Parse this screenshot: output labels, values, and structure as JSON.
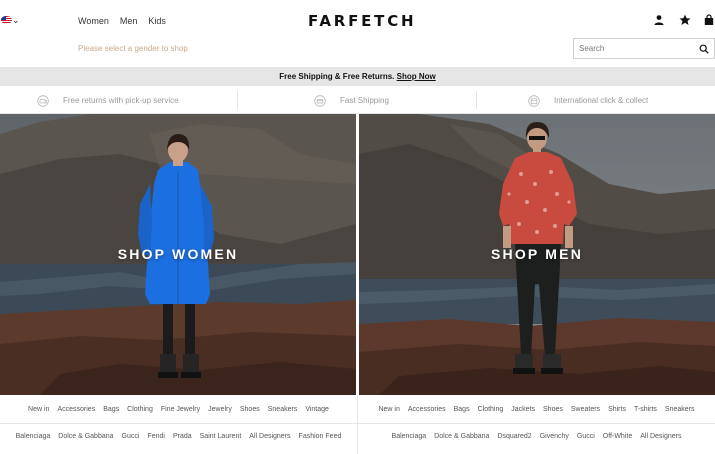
{
  "header": {
    "locale_icon": "us-flag-icon",
    "gender_nav": [
      "Women",
      "Men",
      "Kids"
    ],
    "gender_hint": "Please select a gender to shop",
    "logo": "FARFETCH",
    "search_placeholder": "Search",
    "icons": [
      "account-icon",
      "wishlist-star-icon",
      "bag-icon"
    ]
  },
  "promo": {
    "text": "Free Shipping & Free Returns.",
    "link": "Shop Now"
  },
  "features": [
    {
      "icon": "returns-pickup-icon",
      "label": "Free returns with pick-up service"
    },
    {
      "icon": "fast-shipping-icon",
      "label": "Fast Shipping"
    },
    {
      "icon": "click-collect-icon",
      "label": "International click & collect"
    }
  ],
  "hero": {
    "women": "SHOP WOMEN",
    "men": "SHOP MEN"
  },
  "women_links": {
    "categories": [
      "New in",
      "Accessories",
      "Bags",
      "Clothing",
      "Fine Jewelry",
      "Jewelry",
      "Shoes",
      "Sneakers",
      "Vintage"
    ],
    "designers": [
      "Balenciaga",
      "Dolce & Gabbana",
      "Gucci",
      "Fendi",
      "Prada",
      "Saint Laurent",
      "All Designers",
      "Fashion Feed"
    ]
  },
  "men_links": {
    "categories": [
      "New in",
      "Accessories",
      "Bags",
      "Clothing",
      "Jackets",
      "Shoes",
      "Sweaters",
      "Shirts",
      "T-shirts",
      "Sneakers"
    ],
    "designers": [
      "Balenciaga",
      "Dolce & Gabbana",
      "Dsquared2",
      "Givenchy",
      "Gucci",
      "Off-White",
      "All Designers"
    ]
  },
  "colors": {
    "promo_bg": "#e6e6e6",
    "hint_text": "#c9a98a",
    "women_coat": "#1c6fe0",
    "men_shirt": "#c94a3e",
    "sea": "#3c4a57",
    "sky_right": "#7f8589"
  }
}
